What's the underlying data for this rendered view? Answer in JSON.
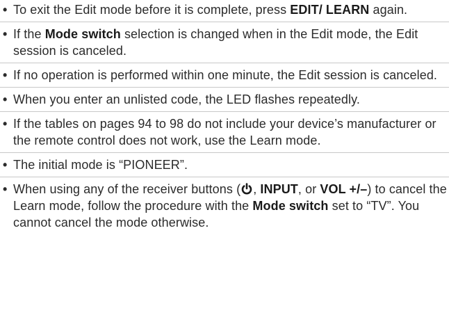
{
  "notes": [
    {
      "segments": [
        {
          "text": "To exit the Edit mode before it is complete, press ",
          "bold": false
        },
        {
          "text": "EDIT/ LEARN",
          "bold": true
        },
        {
          "text": " again.",
          "bold": false
        }
      ]
    },
    {
      "segments": [
        {
          "text": "If the ",
          "bold": false
        },
        {
          "text": "Mode switch",
          "bold": true
        },
        {
          "text": " selection is changed when in the Edit mode, the Edit session is canceled.",
          "bold": false
        }
      ]
    },
    {
      "segments": [
        {
          "text": "If no operation is performed within one minute, the Edit session is canceled.",
          "bold": false
        }
      ]
    },
    {
      "segments": [
        {
          "text": "When you enter an unlisted code, the LED flashes repeatedly.",
          "bold": false
        }
      ]
    },
    {
      "segments": [
        {
          "text": "If the tables on pages 94 to 98 do not include your device’s manufacturer or the remote control does not work, use the Learn mode.",
          "bold": false
        }
      ]
    },
    {
      "segments": [
        {
          "text": "The initial mode is “PIONEER”.",
          "bold": false
        }
      ]
    },
    {
      "segments": [
        {
          "text": "When using any of the receiver buttons (",
          "bold": false
        },
        {
          "icon": "power-icon"
        },
        {
          "text": ", ",
          "bold": false
        },
        {
          "text": "INPUT",
          "bold": true
        },
        {
          "text": ", or ",
          "bold": false
        },
        {
          "text": "VOL +/–",
          "bold": true
        },
        {
          "text": ") to cancel the Learn mode, follow the procedure with the ",
          "bold": false
        },
        {
          "text": "Mode switch",
          "bold": true
        },
        {
          "text": " set to “TV”. You cannot cancel the mode otherwise.",
          "bold": false
        }
      ]
    }
  ],
  "bullet": "•"
}
